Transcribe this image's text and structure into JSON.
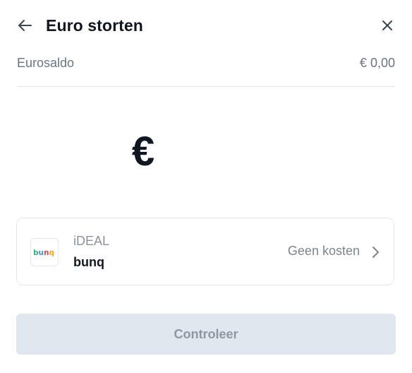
{
  "header": {
    "title": "Euro storten",
    "back_icon": "arrow-left-icon",
    "close_icon": "close-icon"
  },
  "balance": {
    "label": "Eurosaldo",
    "value": "€ 0,00"
  },
  "amount_input": {
    "currency_symbol": "€"
  },
  "payment_method": {
    "type_label": "iDEAL",
    "bank_name": "bunq",
    "logo_text": "bunq",
    "fee_label": "Geen kosten",
    "chevron_icon": "chevron-right-icon"
  },
  "submit": {
    "label": "Controleer",
    "state": "disabled"
  },
  "colors": {
    "title_text": "#111722",
    "muted_text": "#6b7684",
    "divider": "#e3e6ea",
    "button_disabled_bg": "#e1e7ef",
    "button_disabled_text": "#8d97a3"
  }
}
